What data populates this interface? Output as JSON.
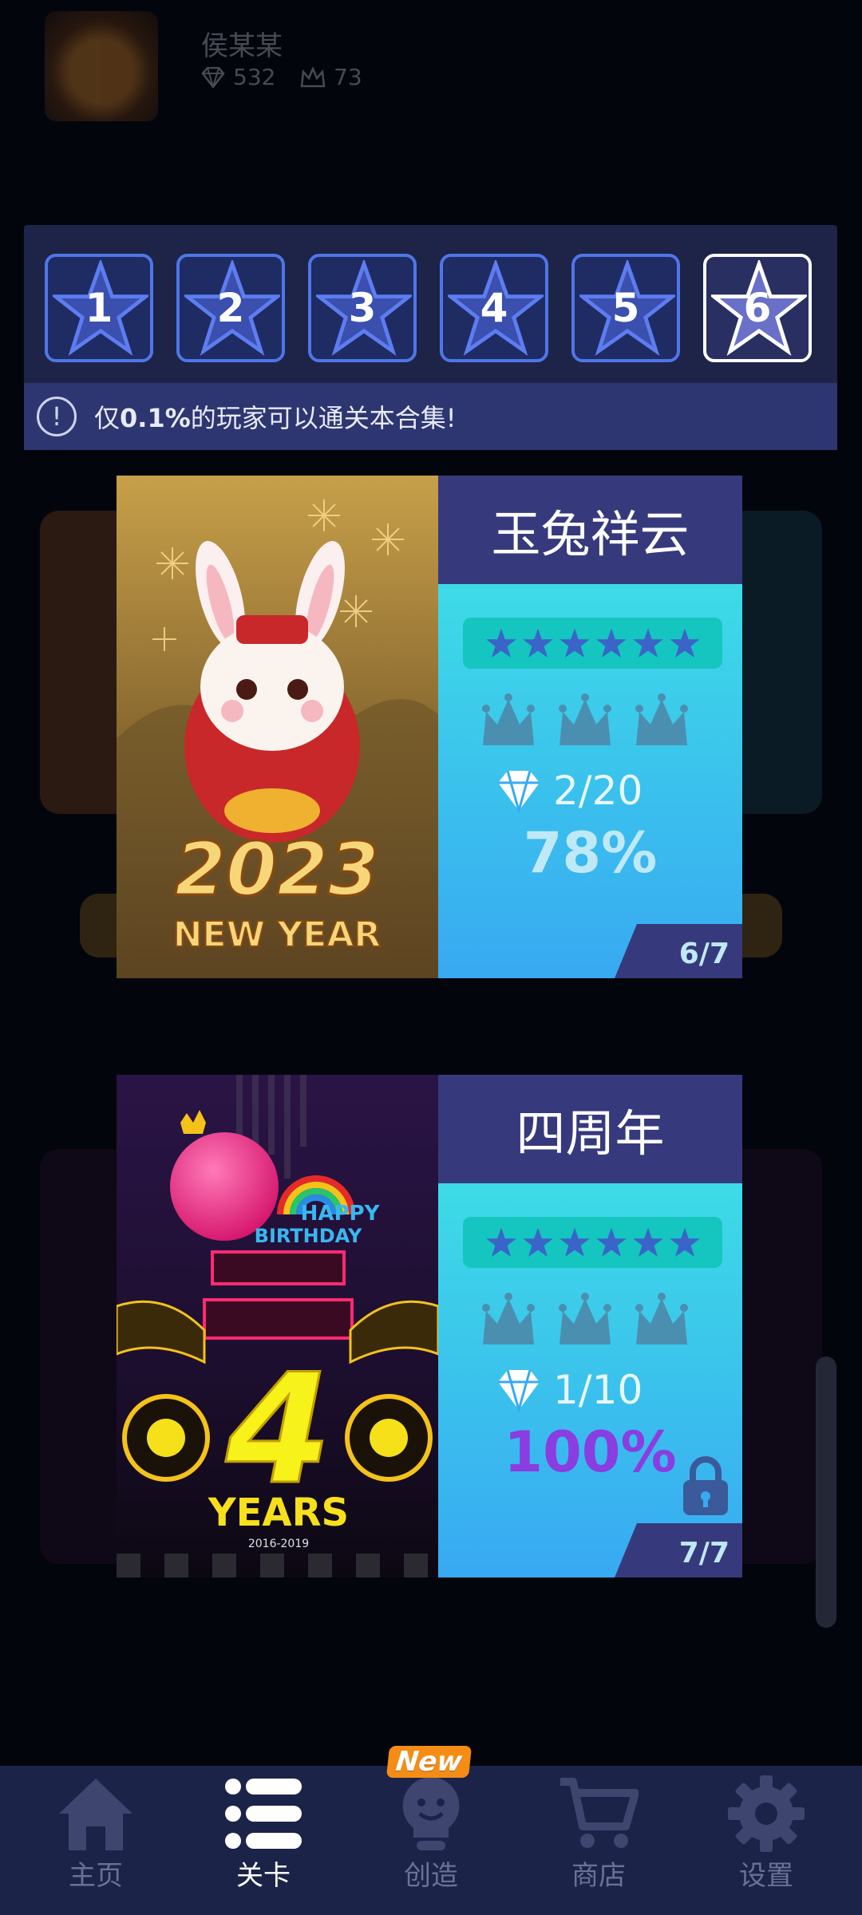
{
  "profile": {
    "name": "侯某某",
    "gems": "532",
    "crowns": "73"
  },
  "levels": [
    "1",
    "2",
    "3",
    "4",
    "5",
    "6"
  ],
  "selected_level": "6",
  "notice": {
    "prefix": "仅",
    "highlight": "0.1%",
    "suffix": "的玩家可以通关本合集!"
  },
  "cards": [
    {
      "title": "玉兔祥云",
      "art_text_year": "2023",
      "art_text_sub": "NEW YEAR",
      "gems": "2/20",
      "percent": "78%",
      "count": "6/7",
      "locked": false
    },
    {
      "title": "四周年",
      "art_text_happy": "HAPPY",
      "art_text_birthday": "BIRTHDAY",
      "art_text_big": "4",
      "art_text_years": "YEARS",
      "art_text_range": "2016-2019",
      "gems": "1/10",
      "percent": "100%",
      "count": "7/7",
      "locked": true
    }
  ],
  "nav": {
    "items": [
      {
        "label": "主页",
        "icon": "home-icon"
      },
      {
        "label": "关卡",
        "icon": "list-icon"
      },
      {
        "label": "创造",
        "icon": "lightbulb-icon"
      },
      {
        "label": "商店",
        "icon": "cart-icon"
      },
      {
        "label": "设置",
        "icon": "gear-icon"
      }
    ],
    "active": "关卡",
    "new_badge": "New"
  },
  "colors": {
    "accent": "#4f76e8",
    "card_title_bg": "#363a7c",
    "nav_bg": "#1b2348",
    "percent_complete": "#8a3de0"
  }
}
